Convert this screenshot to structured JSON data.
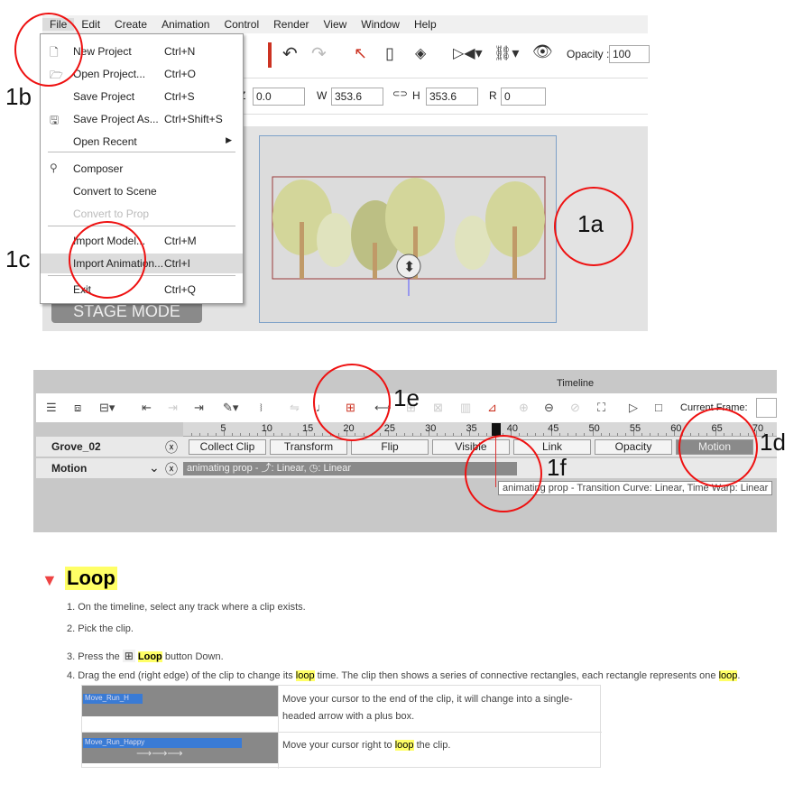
{
  "menubar": [
    "File",
    "Edit",
    "Create",
    "Animation",
    "Control",
    "Render",
    "View",
    "Window",
    "Help"
  ],
  "toolbar": {
    "opacity_label": "Opacity :",
    "opacity_value": "100"
  },
  "props": {
    "z_label": "Z",
    "z_value": "0.0",
    "w_label": "W",
    "w_value": "353.6",
    "h_label": "H",
    "h_value": "353.6",
    "r_label": "R",
    "r_value": "0"
  },
  "file_menu": [
    {
      "label": "New Project",
      "shortcut": "Ctrl+N",
      "icon": "new-file-icon"
    },
    {
      "label": "Open Project...",
      "shortcut": "Ctrl+O",
      "icon": "folder-icon"
    },
    {
      "label": "Save Project",
      "shortcut": "Ctrl+S"
    },
    {
      "label": "Save Project As...",
      "shortcut": "Ctrl+Shift+S",
      "icon": "save-icon"
    },
    {
      "label": "Open Recent",
      "shortcut": ""
    },
    {
      "label": "Composer",
      "shortcut": "",
      "icon": "composer-icon"
    },
    {
      "label": "Convert to Scene",
      "shortcut": ""
    },
    {
      "label": "Convert to Prop",
      "shortcut": "",
      "disabled": true
    },
    {
      "label": "Import Model...",
      "shortcut": "Ctrl+M"
    },
    {
      "label": "Import Animation...",
      "shortcut": "Ctrl+I",
      "highlighted": true
    },
    {
      "label": "Exit",
      "shortcut": "Ctrl+Q"
    }
  ],
  "stage_mode": "STAGE MODE",
  "annotations": {
    "a": "1a",
    "b": "1b",
    "c": "1c",
    "d": "1d",
    "e": "1e",
    "f": "1f"
  },
  "timeline": {
    "title": "Timeline",
    "current_frame_label": "Current Frame:",
    "ruler": [
      "5",
      "10",
      "15",
      "20",
      "25",
      "30",
      "35",
      "40",
      "45",
      "50",
      "55",
      "60",
      "65",
      "70"
    ],
    "track": "Grove_02",
    "chips": [
      "Collect Clip",
      "Transform",
      "Flip",
      "Visible",
      "Link",
      "Opacity",
      "Motion"
    ],
    "motion_label": "Motion",
    "clip": {
      "prefix": "animating prop - ",
      "curve": ": Linear,",
      "warp": ": Linear"
    },
    "tooltip": "animating prop - Transition Curve: Linear, Time Warp: Linear"
  },
  "doc": {
    "title": "Loop",
    "step1": "1.  On the timeline, select any track where a clip exists.",
    "step2": "2.  Pick the clip.",
    "step3a": "3.  Press the",
    "step3b": "Loop",
    "step3c": " button Down.",
    "step4a": "4.  Drag the end (right edge) of the clip to change its ",
    "step4b": "loop",
    "step4c": " time. The clip then shows a series of connective rectangles, each rectangle represents one ",
    "step4d": "loop",
    "step4e": ".",
    "clip1": "Move_Run_H",
    "clip2": "Move_Run_Happy",
    "row1": "Move your cursor to the end of the clip, it will change into a single-headed arrow with a plus box.",
    "row2a": "Move your cursor right to ",
    "row2b": "loop",
    "row2c": " the clip."
  },
  "colors": {
    "annotation": "#ee1111",
    "accent": "#cc3322",
    "highlight": "#ffff66",
    "clip_blue": "#3a7bd5"
  }
}
